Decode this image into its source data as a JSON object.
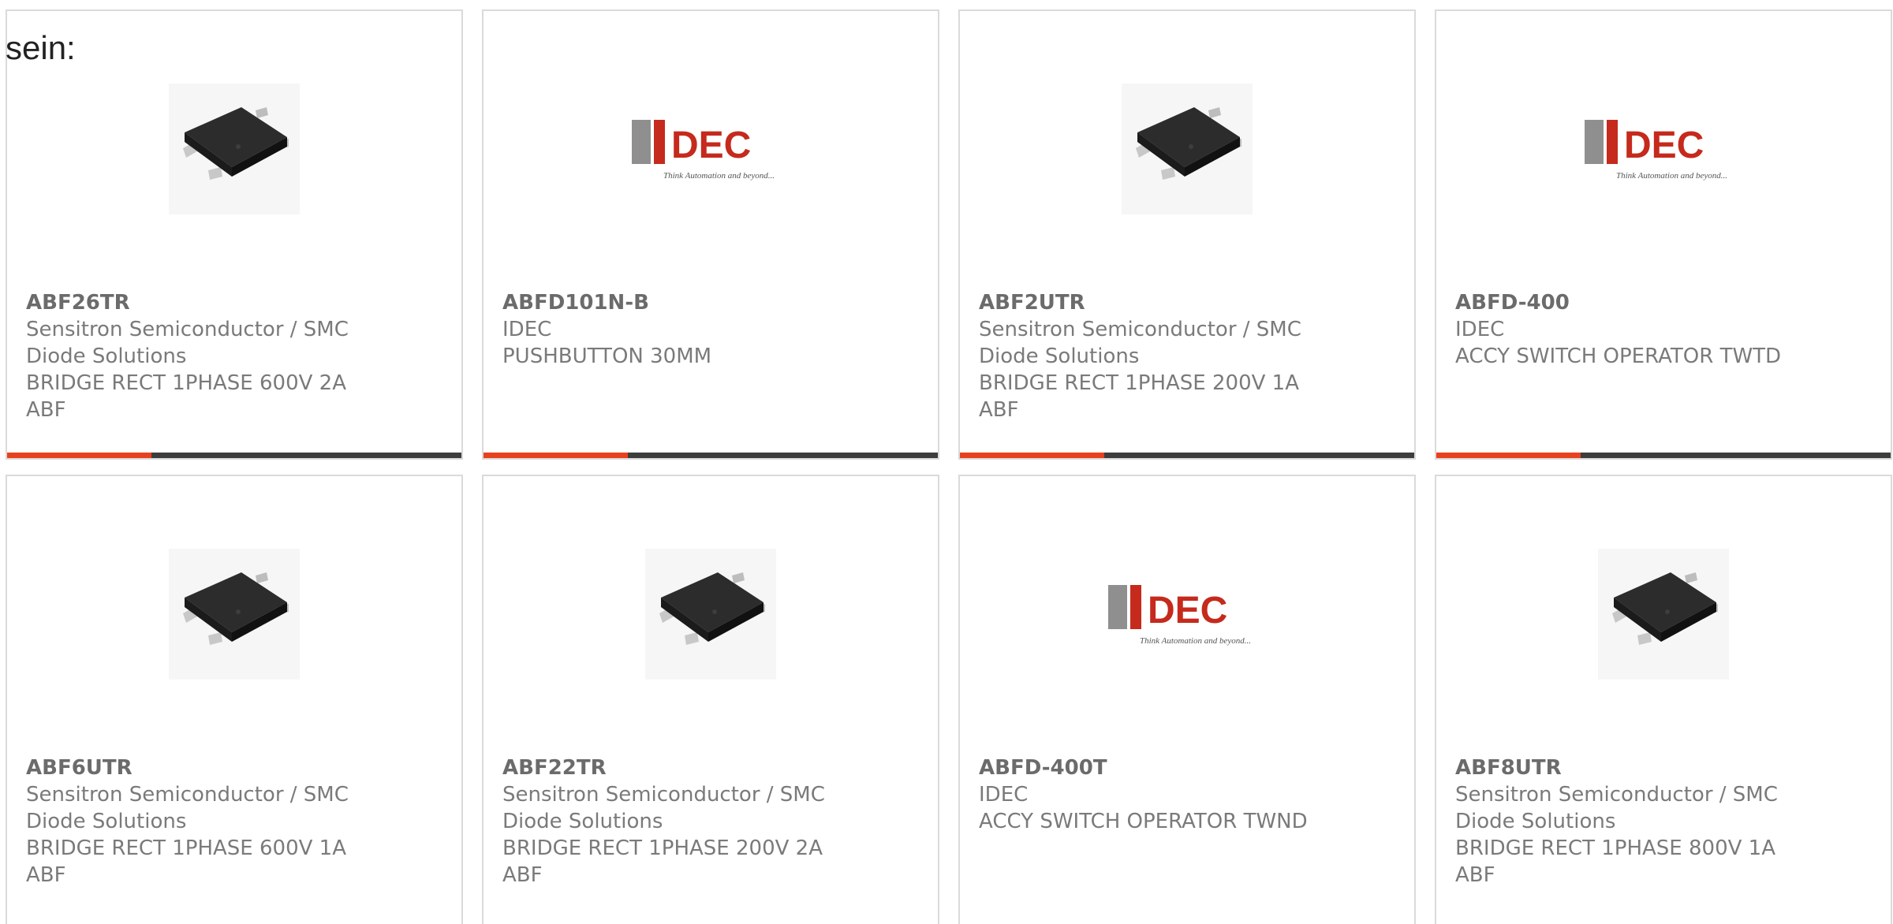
{
  "lead_text": "sein:",
  "colors": {
    "accent": "#e8411e",
    "bar": "#3d3d3d",
    "border": "#dadada",
    "text": "#7a7a7a"
  },
  "products": [
    {
      "part_number": "ABF26TR",
      "manufacturer": "Sensitron Semiconductor / SMC Diode Solutions",
      "mfr_line1": "Sensitron Semiconductor / SMC",
      "mfr_line2": "Diode Solutions",
      "description": "BRIDGE RECT 1PHASE 600V 2A",
      "series": "ABF",
      "image": "bridge-rectifier-chip-icon"
    },
    {
      "part_number": "ABFD101N-B",
      "manufacturer": "IDEC",
      "mfr_line1": "IDEC",
      "mfr_line2": "",
      "description": "PUSHBUTTON 30MM",
      "series": "",
      "image": "idec-logo"
    },
    {
      "part_number": "ABF2UTR",
      "manufacturer": "Sensitron Semiconductor / SMC Diode Solutions",
      "mfr_line1": "Sensitron Semiconductor / SMC",
      "mfr_line2": "Diode Solutions",
      "description": "BRIDGE RECT 1PHASE 200V 1A",
      "series": "ABF",
      "image": "bridge-rectifier-chip-icon"
    },
    {
      "part_number": "ABFD-400",
      "manufacturer": "IDEC",
      "mfr_line1": "IDEC",
      "mfr_line2": "",
      "description": "ACCY SWITCH OPERATOR TWTD",
      "series": "",
      "image": "idec-logo"
    },
    {
      "part_number": "ABF6UTR",
      "manufacturer": "Sensitron Semiconductor / SMC Diode Solutions",
      "mfr_line1": "Sensitron Semiconductor / SMC",
      "mfr_line2": "Diode Solutions",
      "description": "BRIDGE RECT 1PHASE 600V 1A",
      "series": "ABF",
      "image": "bridge-rectifier-chip-icon"
    },
    {
      "part_number": "ABF22TR",
      "manufacturer": "Sensitron Semiconductor / SMC Diode Solutions",
      "mfr_line1": "Sensitron Semiconductor / SMC",
      "mfr_line2": "Diode Solutions",
      "description": "BRIDGE RECT 1PHASE 200V 2A",
      "series": "ABF",
      "image": "bridge-rectifier-chip-icon"
    },
    {
      "part_number": "ABFD-400T",
      "manufacturer": "IDEC",
      "mfr_line1": "IDEC",
      "mfr_line2": "",
      "description": "ACCY SWITCH OPERATOR TWND",
      "series": "",
      "image": "idec-logo"
    },
    {
      "part_number": "ABF8UTR",
      "manufacturer": "Sensitron Semiconductor / SMC Diode Solutions",
      "mfr_line1": "Sensitron Semiconductor / SMC",
      "mfr_line2": "Diode Solutions",
      "description": "BRIDGE RECT 1PHASE 800V 1A",
      "series": "ABF",
      "image": "bridge-rectifier-chip-icon"
    }
  ],
  "logo": {
    "brand": "IDEC",
    "tagline": "Think Automation and beyond..."
  }
}
